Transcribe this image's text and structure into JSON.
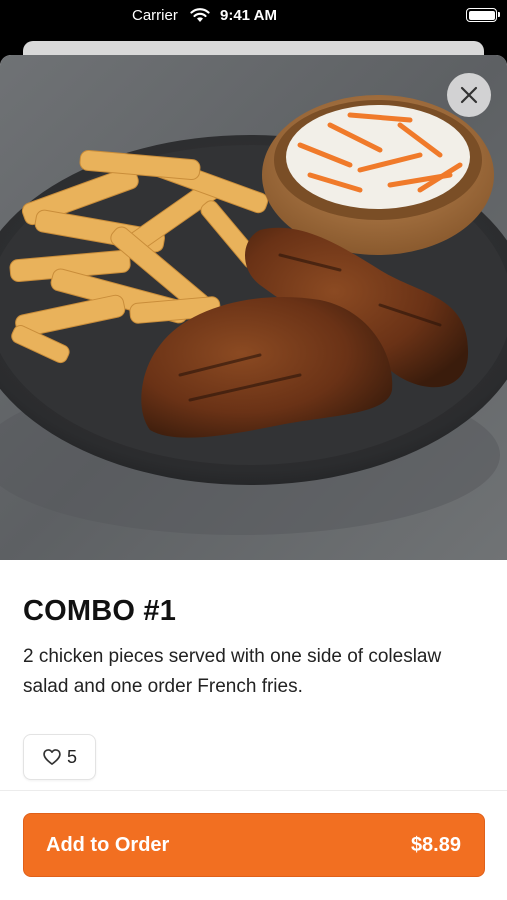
{
  "status_bar": {
    "carrier": "Carrier",
    "time": "9:41 AM"
  },
  "item": {
    "image_icon": "food-photo",
    "title": "COMBO #1",
    "description": "2 chicken pieces served with one side of coleslaw salad and one order French fries.",
    "likes": "5"
  },
  "actions": {
    "close_icon": "close-icon",
    "like_icon": "heart-icon"
  },
  "order": {
    "label": "Add to Order",
    "price": "$8.89"
  },
  "colors": {
    "accent": "#f26f21",
    "text": "#111111"
  }
}
